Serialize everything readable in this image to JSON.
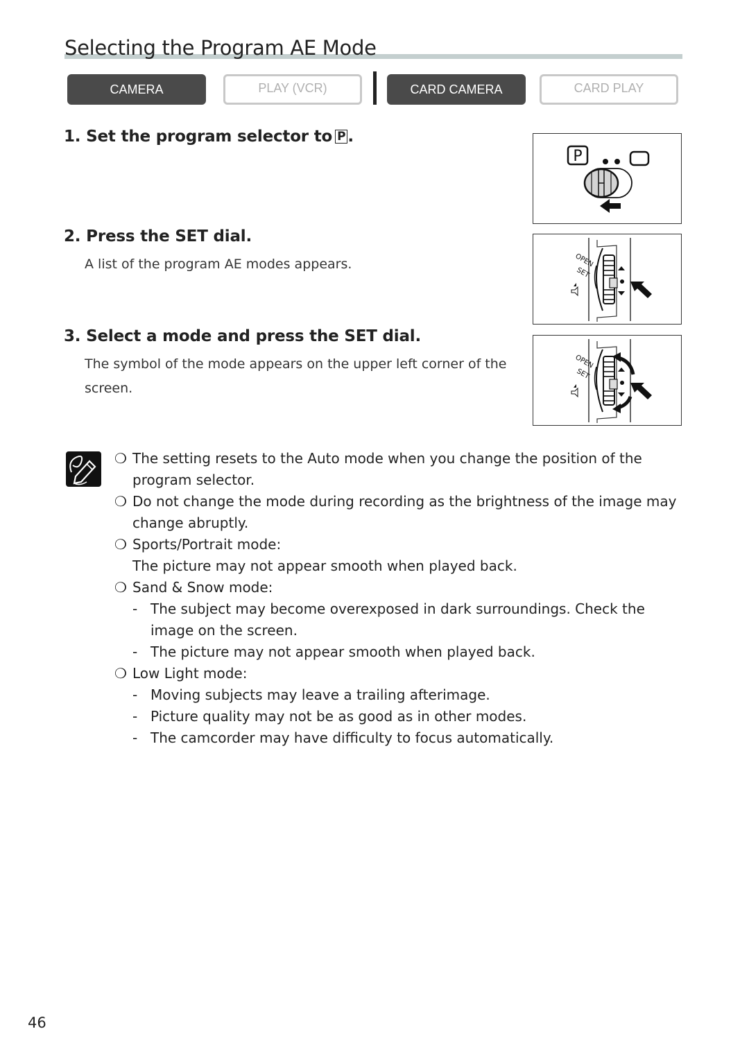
{
  "page": {
    "title": "Selecting the Program AE Mode",
    "page_number": "46"
  },
  "mode_bar": {
    "buttons": [
      {
        "label": "CAMERA",
        "state": "active"
      },
      {
        "label": "PLAY (VCR)",
        "state": "inactive"
      },
      {
        "label": "CARD CAMERA",
        "state": "active"
      },
      {
        "label": "CARD PLAY",
        "state": "inactive"
      }
    ]
  },
  "steps": [
    {
      "number": "1.",
      "heading": "Set the program selector to",
      "symbol": "P",
      "suffix": ".",
      "body": ""
    },
    {
      "number": "2.",
      "heading": "Press the SET dial.",
      "body": "A list of the program AE modes appears."
    },
    {
      "number": "3.",
      "heading": "Select a mode and press the SET dial.",
      "body_lines": [
        "The symbol of the mode appears on the upper left corner of the",
        "screen."
      ]
    }
  ],
  "figures": [
    {
      "name": "program-selector-figure",
      "labels": {
        "p": "P"
      }
    },
    {
      "name": "set-dial-press-figure",
      "labels": {
        "open": "OPEN",
        "set": "SET"
      }
    },
    {
      "name": "set-dial-turn-figure",
      "labels": {
        "open": "OPEN",
        "set": "SET"
      }
    }
  ],
  "notes": {
    "icon": "pencil-note-icon",
    "bullet": "❍",
    "dash": "-",
    "items": [
      {
        "lines": [
          "The setting resets to the Auto mode when you change the position of the",
          "program selector."
        ]
      },
      {
        "lines": [
          "Do not change the mode during recording as the brightness of the image may",
          "change abruptly."
        ]
      },
      {
        "lines": [
          "Sports/Portrait mode:",
          "The picture may not appear smooth when played back."
        ]
      },
      {
        "lines": [
          "Sand & Snow mode:"
        ],
        "subs": [
          [
            "The subject may become overexposed in dark surroundings. Check the",
            "image on the screen."
          ],
          [
            "The picture may not appear smooth when played back."
          ]
        ]
      },
      {
        "lines": [
          "Low Light mode:"
        ],
        "subs": [
          [
            "Moving subjects may leave a trailing afterimage."
          ],
          [
            "Picture quality may not be as good as in other modes."
          ],
          [
            "The camcorder may have difficulty to focus automatically."
          ]
        ]
      }
    ]
  }
}
